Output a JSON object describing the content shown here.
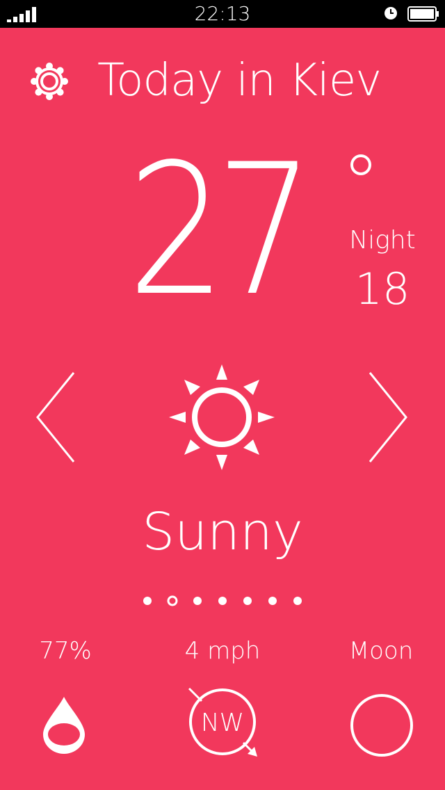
{
  "status_bar": {
    "time": "22:13",
    "signal_icon": "signal-bars-icon",
    "alarm_icon": "alarm-clock-icon",
    "battery_icon": "battery-icon"
  },
  "header": {
    "title": "Today in Kiev",
    "settings_icon": "gear-icon"
  },
  "current": {
    "temperature": "27",
    "degree_symbol": "degree-icon",
    "night_label": "Night",
    "night_temperature": "18",
    "condition": "Sunny",
    "condition_icon": "sun-icon"
  },
  "navigation": {
    "prev_icon": "chevron-left-icon",
    "next_icon": "chevron-right-icon",
    "page_count": 7,
    "active_page": 2
  },
  "stats": {
    "humidity": "77%",
    "humidity_icon": "water-drop-icon",
    "wind_speed": "4 mph",
    "wind_direction": "NW",
    "wind_icon": "compass-icon",
    "moon_label": "Moon",
    "moon_icon": "moon-phase-icon"
  },
  "colors": {
    "background": "#f2385c",
    "foreground": "#ffffff",
    "status_bar": "#000000"
  }
}
